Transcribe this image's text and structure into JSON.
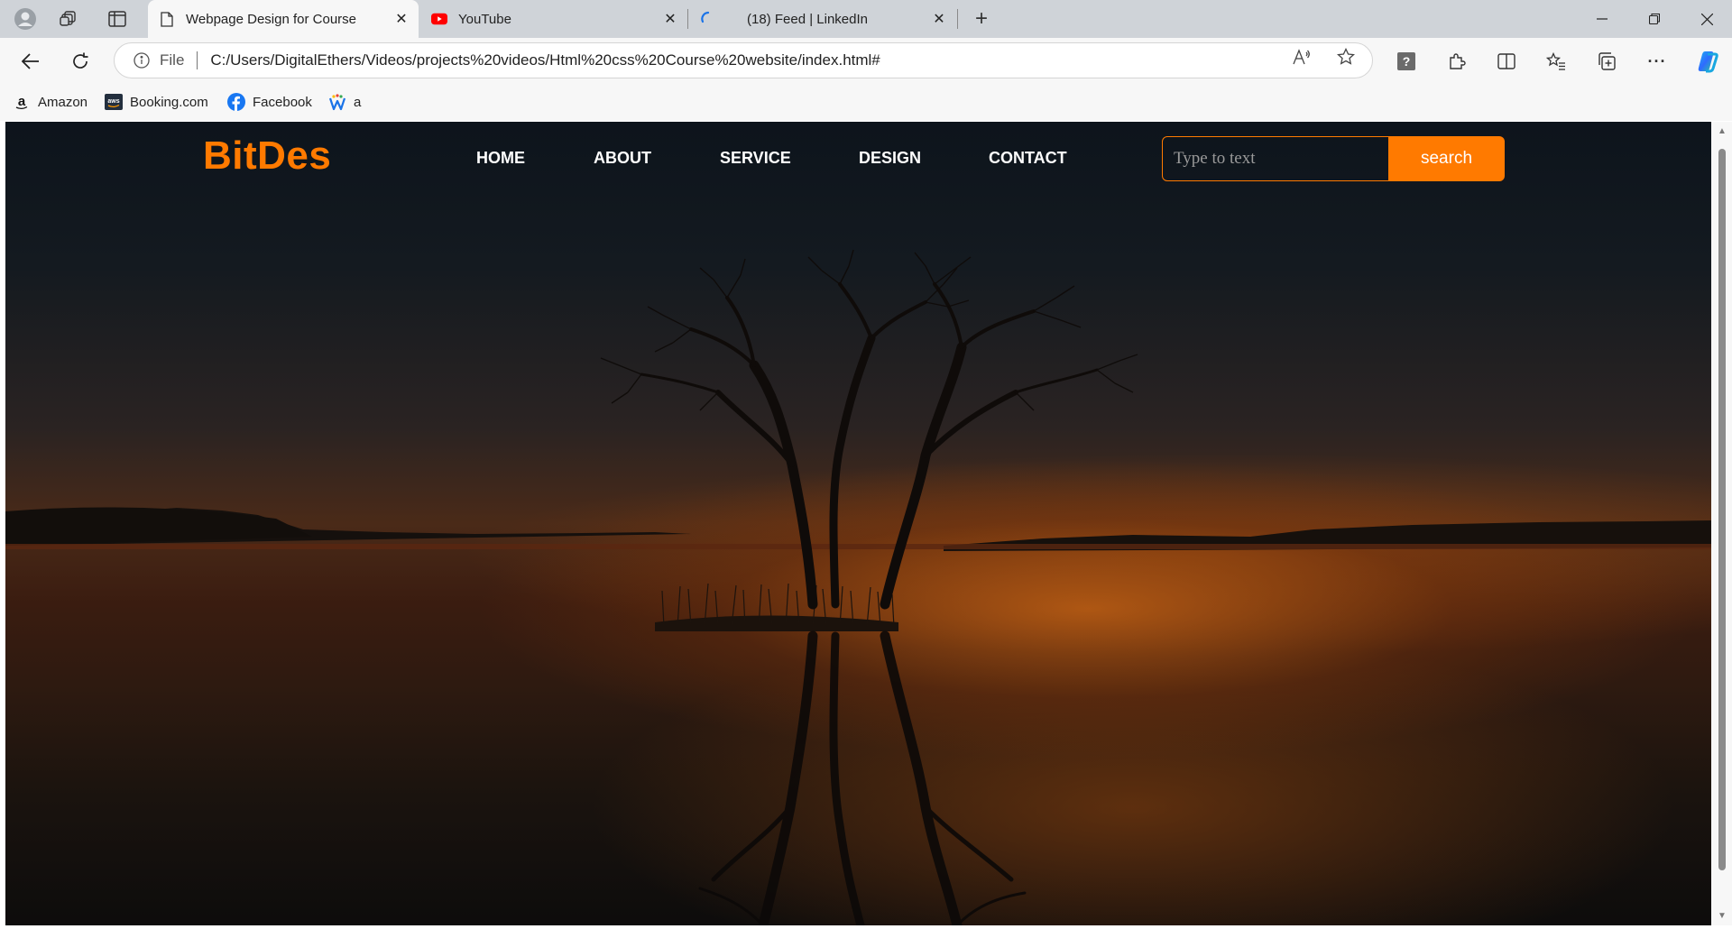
{
  "browser": {
    "tabs": [
      {
        "title": "Webpage Design for Course",
        "active": true,
        "favicon": "page-icon"
      },
      {
        "title": "YouTube",
        "active": false,
        "favicon": "youtube-icon"
      },
      {
        "title": "(18) Feed | LinkedIn",
        "active": false,
        "favicon": "loading-icon"
      }
    ],
    "address": {
      "scheme_label": "File",
      "url": "C:/Users/DigitalEthers/Videos/projects%20videos/Html%20css%20Course%20website/index.html#"
    },
    "favorites": [
      {
        "label": "Amazon",
        "icon": "amazon-icon"
      },
      {
        "label": "Booking.com",
        "icon": "aws-icon"
      },
      {
        "label": "Facebook",
        "icon": "facebook-icon"
      },
      {
        "label": "a",
        "icon": "w-icon"
      }
    ]
  },
  "site": {
    "logo": "BitDes",
    "nav": [
      "HOME",
      "ABOUT",
      "SERVICE",
      "DESIGN",
      "CONTACT"
    ],
    "search": {
      "placeholder": "Type to text",
      "button": "search"
    },
    "accent_color": "#ff7a00"
  }
}
